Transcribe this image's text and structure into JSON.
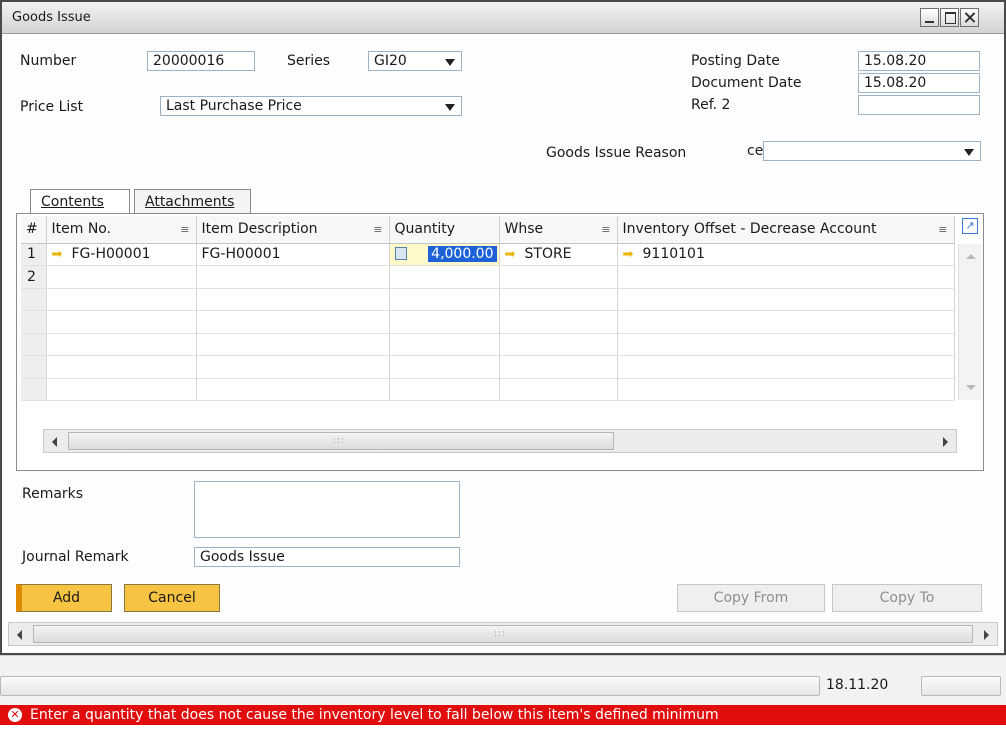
{
  "window": {
    "title": "Goods Issue"
  },
  "header": {
    "number_label": "Number",
    "number_value": "20000016",
    "series_label": "Series",
    "series_value": "GI20",
    "price_list_label": "Price List",
    "price_list_value": "Last Purchase Price",
    "posting_date_label": "Posting Date",
    "posting_date_value": "15.08.20",
    "document_date_label": "Document Date",
    "document_date_value": "15.08.20",
    "ref2_label": "Ref. 2",
    "ref2_value": "",
    "reason_label": "Goods Issue Reason",
    "reason_prefix": "ce",
    "reason_value": ""
  },
  "tabs": [
    {
      "label": "Contents",
      "active": true
    },
    {
      "label": "Attachments",
      "active": false
    }
  ],
  "grid": {
    "columns": [
      "#",
      "Item No.",
      "Item Description",
      "Quantity",
      "Whse",
      "Inventory Offset - Decrease Account"
    ],
    "rows": [
      {
        "num": "1",
        "item_no": "FG-H00001",
        "description": "FG-H00001",
        "quantity": "4,000.00",
        "whse": "STORE",
        "account": "9110101"
      },
      {
        "num": "2",
        "item_no": "",
        "description": "",
        "quantity": "",
        "whse": "",
        "account": ""
      }
    ]
  },
  "footer": {
    "remarks_label": "Remarks",
    "journal_remark_label": "Journal Remark",
    "journal_remark_value": "Goods Issue"
  },
  "buttons": {
    "add": "Add",
    "cancel": "Cancel",
    "copy_from": "Copy From",
    "copy_to": "Copy To"
  },
  "status": {
    "date": "18.11.20",
    "error_message": "Enter a quantity that does not cause the inventory level to fall below this item's defined minimum"
  },
  "colors": {
    "error": "#e10d0d",
    "button": "#f7c342",
    "selection": "#1d62d8"
  }
}
